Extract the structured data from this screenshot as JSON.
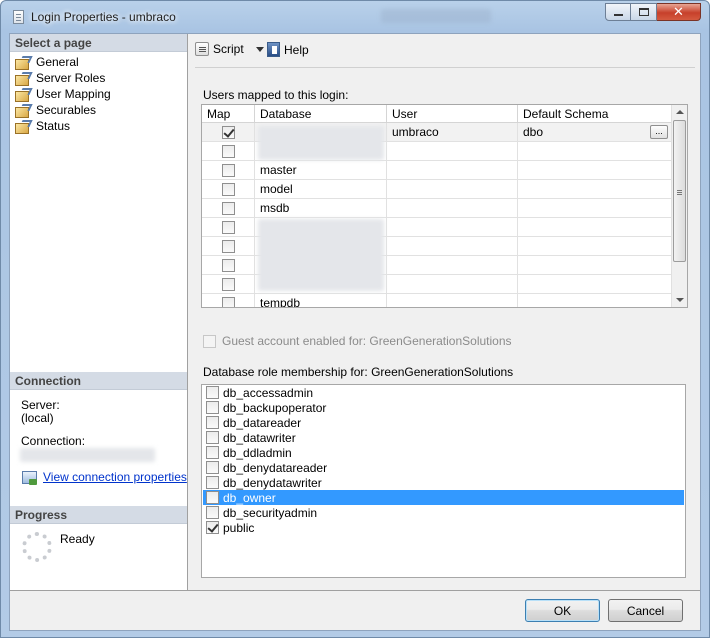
{
  "window": {
    "title": "Login Properties - umbraco"
  },
  "left": {
    "select_header": "Select a page",
    "pages": [
      "General",
      "Server Roles",
      "User Mapping",
      "Securables",
      "Status"
    ],
    "connection_header": "Connection",
    "server_label": "Server:",
    "server_value": "(local)",
    "connection_label": "Connection:",
    "view_link": "View connection properties",
    "progress_header": "Progress",
    "progress_status": "Ready"
  },
  "toolbar": {
    "script_label": "Script",
    "help_label": "Help"
  },
  "mapping": {
    "label": "Users mapped to this login:",
    "columns": [
      "Map",
      "Database",
      "User",
      "Default Schema"
    ],
    "rows": [
      {
        "checked": true,
        "database": "",
        "user": "umbraco",
        "schema": "dbo",
        "selected": true
      },
      {
        "checked": false,
        "database": "",
        "user": "",
        "schema": ""
      },
      {
        "checked": false,
        "database": "master",
        "user": "",
        "schema": ""
      },
      {
        "checked": false,
        "database": "model",
        "user": "",
        "schema": ""
      },
      {
        "checked": false,
        "database": "msdb",
        "user": "",
        "schema": ""
      },
      {
        "checked": false,
        "database": "",
        "user": "",
        "schema": ""
      },
      {
        "checked": false,
        "database": "",
        "user": "",
        "schema": ""
      },
      {
        "checked": false,
        "database": "",
        "user": "",
        "schema": ""
      },
      {
        "checked": false,
        "database": "",
        "user": "",
        "schema": ""
      },
      {
        "checked": false,
        "database": "tempdb",
        "user": "",
        "schema": ""
      }
    ],
    "ellipsis": "..."
  },
  "guest": {
    "label": "Guest account enabled for: GreenGenerationSolutions"
  },
  "roles": {
    "label": "Database role membership for: GreenGenerationSolutions",
    "items": [
      {
        "name": "db_accessadmin",
        "checked": false
      },
      {
        "name": "db_backupoperator",
        "checked": false
      },
      {
        "name": "db_datareader",
        "checked": false
      },
      {
        "name": "db_datawriter",
        "checked": false
      },
      {
        "name": "db_ddladmin",
        "checked": false
      },
      {
        "name": "db_denydatareader",
        "checked": false
      },
      {
        "name": "db_denydatawriter",
        "checked": false
      },
      {
        "name": "db_owner",
        "checked": false,
        "selected": true
      },
      {
        "name": "db_securityadmin",
        "checked": false
      },
      {
        "name": "public",
        "checked": true
      }
    ]
  },
  "buttons": {
    "ok": "OK",
    "cancel": "Cancel"
  },
  "icons": {
    "window": "document-icon",
    "page": "page-icon",
    "script": "script-icon",
    "help": "help-icon",
    "link": "connection-properties-icon",
    "progress": "spinner-icon"
  },
  "colors": {
    "selection": "#3399ff",
    "link": "#0033cc",
    "title_bar": "#b9d1ea"
  }
}
